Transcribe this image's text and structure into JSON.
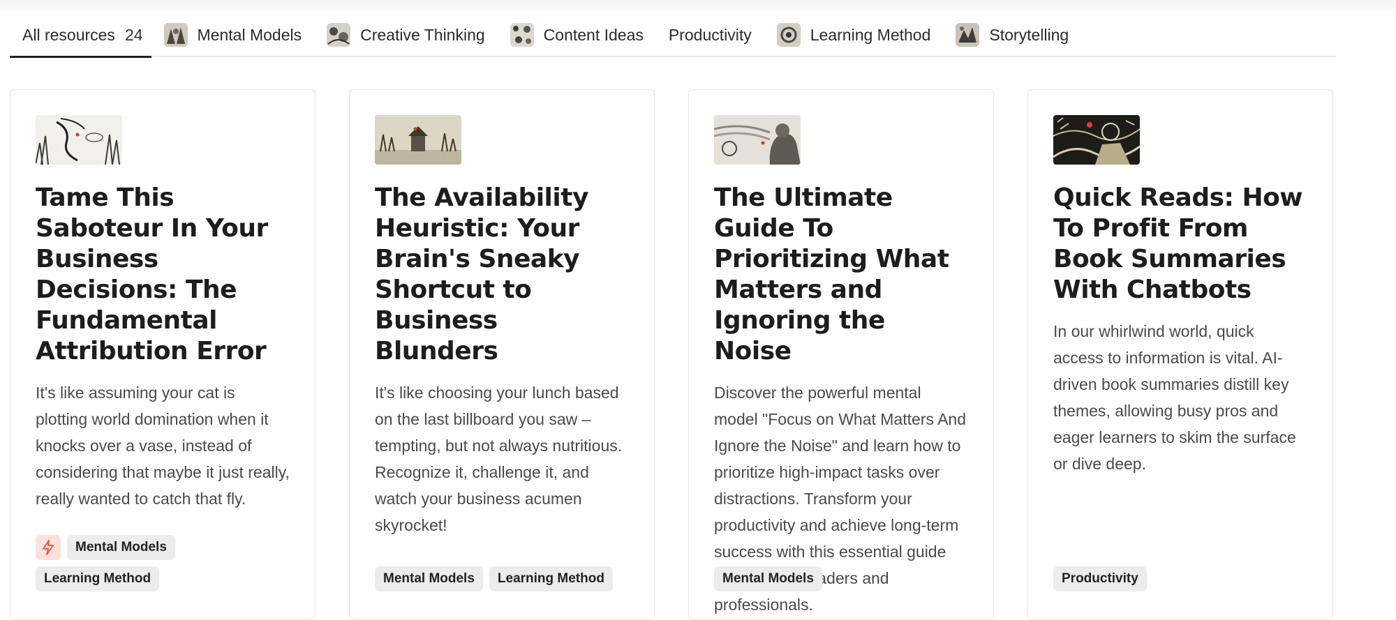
{
  "tabs": [
    {
      "label": "All resources",
      "count": "24",
      "active": true,
      "icon": null
    },
    {
      "label": "Mental Models",
      "icon": "mental-models-thumb-icon"
    },
    {
      "label": "Creative Thinking",
      "icon": "creative-thinking-thumb-icon"
    },
    {
      "label": "Content Ideas",
      "icon": "content-ideas-thumb-icon"
    },
    {
      "label": "Productivity",
      "icon": null
    },
    {
      "label": "Learning Method",
      "icon": "learning-method-thumb-icon"
    },
    {
      "label": "Storytelling",
      "icon": "storytelling-thumb-icon"
    }
  ],
  "cards": [
    {
      "title": "Tame This Saboteur In Your Business Decisions: The Fundamental Attribution Error",
      "description": "It's like assuming your cat is plotting world domination when it knocks over a vase, instead of considering that maybe it just really, really wanted to catch that fly.",
      "tags": [
        "Mental Models",
        "Learning Method"
      ],
      "featured_icon": "lightning-bolt-icon"
    },
    {
      "title": "The Availability Heuristic: Your Brain's Sneaky Shortcut to Business Blunders",
      "description": "It's like choosing your lunch based on the last billboard you saw – tempting, but not always nutritious. Recognize it, challenge it, and watch your business acumen skyrocket!",
      "tags": [
        "Mental Models",
        "Learning Method"
      ]
    },
    {
      "title": "The Ultimate Guide To Prioritizing What Matters and Ignoring the Noise",
      "description": "Discover the powerful mental model \"Focus on What Matters And Ignore the Noise\" and learn how to prioritize high-impact tasks over distractions. Transform your productivity and achieve long-term success with this essential guide for business leaders and professionals.",
      "tags": [
        "Mental Models"
      ]
    },
    {
      "title": "Quick Reads: How To Profit From Book Summaries With Chatbots",
      "description": "In our whirlwind world, quick access to information is vital. AI-driven book summaries distill key themes, allowing busy pros and eager learners to skim the surface or dive deep.",
      "tags": [
        "Productivity"
      ]
    }
  ],
  "colors": {
    "accent_bolt_bg": "#fde0dc",
    "accent_bolt": "#e0533f",
    "tag_bg": "#ececec"
  }
}
